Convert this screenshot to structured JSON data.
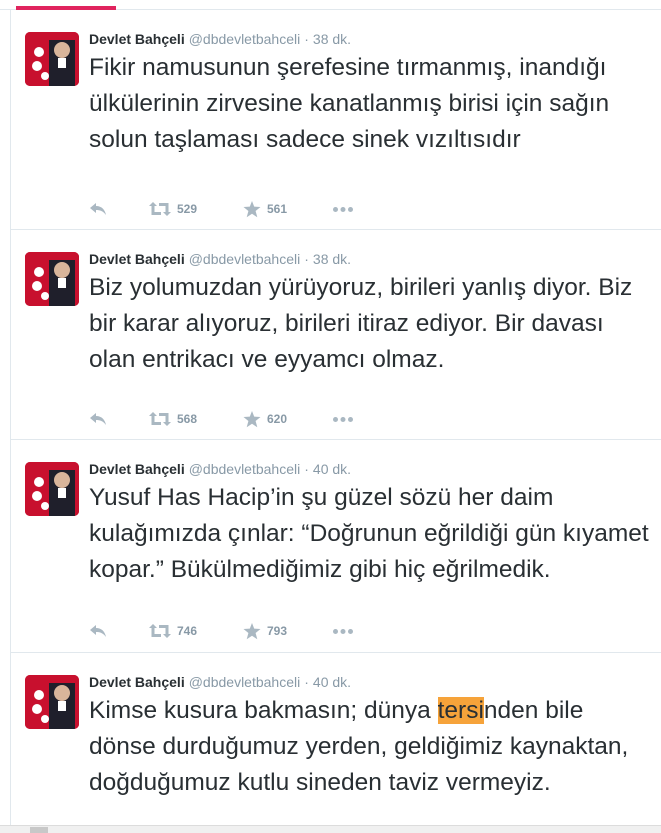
{
  "colors": {
    "accent": "#e0245e",
    "highlight": "#f6a33a",
    "muted": "#8899a6",
    "icon": "#aab8c2"
  },
  "tweets": [
    {
      "name": "Devlet Bahçeli",
      "handle": "@dbdevletbahceli",
      "time": "38 dk.",
      "text": "Fikir namusunun şerefesine tırmanmış, inandığı ülkülerinin zirvesine kanatlanmış birisi için sağın solun taşlaması sadece sinek vızıltısıdır",
      "retweets": "529",
      "favorites": "561"
    },
    {
      "name": "Devlet Bahçeli",
      "handle": "@dbdevletbahceli",
      "time": "38 dk.",
      "text": "Biz yolumuzdan yürüyoruz, birileri yanlış diyor. Biz bir karar alıyoruz, birileri itiraz ediyor. Bir davası olan entrikacı ve eyyamcı olmaz.",
      "retweets": "568",
      "favorites": "620"
    },
    {
      "name": "Devlet Bahçeli",
      "handle": "@dbdevletbahceli",
      "time": "40 dk.",
      "text": "Yusuf Has Hacip’in şu güzel sözü her daim kulağımızda çınlar: “Doğrunun eğrildiği gün kıyamet kopar.” Bükülmediğimiz gibi hiç eğrilmedik.",
      "retweets": "746",
      "favorites": "793"
    },
    {
      "name": "Devlet Bahçeli",
      "handle": "@dbdevletbahceli",
      "time": "40 dk.",
      "text_before": "Kimse kusura bakmasın; dünya ",
      "text_highlight": "tersi",
      "text_after": "nden bile dönse durduğumuz yerden, geldiğimiz kaynaktan, doğduğumuz kutlu sineden taviz vermeyiz."
    }
  ],
  "separator": "·"
}
